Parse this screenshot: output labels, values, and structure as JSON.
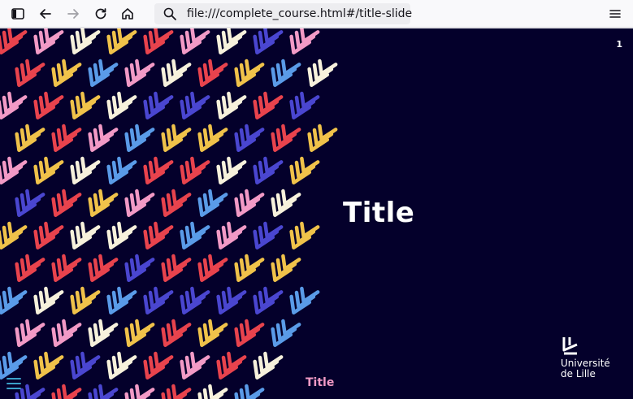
{
  "browser": {
    "url": "file:///complete_course.html#/title-slide",
    "icons": [
      "sidebar-icon",
      "back-icon",
      "forward-icon",
      "reload-icon",
      "home-icon",
      "search-icon",
      "menu-icon"
    ]
  },
  "slide": {
    "number": "1",
    "title": "Title",
    "footer_title": "Title",
    "logo": {
      "line1": "Université",
      "line2": "de Lille"
    }
  },
  "colors": {
    "background": "#04002b",
    "accent_pink": "#f29ac6",
    "menu_teal": "#3aa0c8",
    "pattern": [
      "#f7f1dc",
      "#f0c24a",
      "#e8434d",
      "#f29ac6",
      "#5a9be8",
      "#4a46d0"
    ]
  }
}
